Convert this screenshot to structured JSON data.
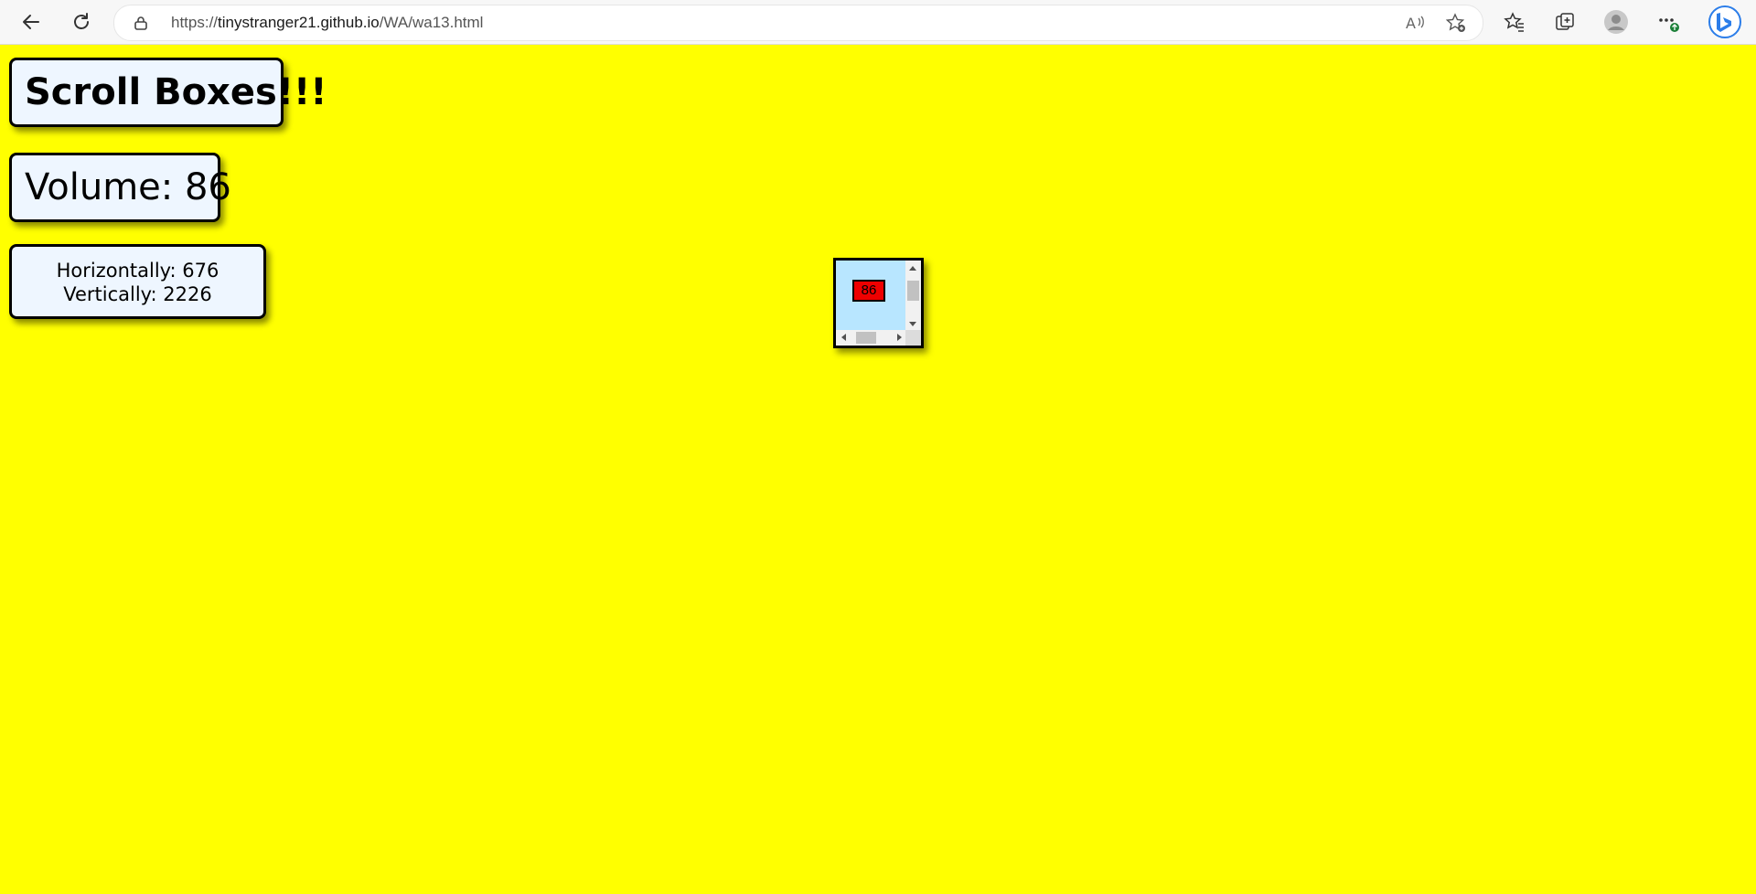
{
  "browser": {
    "url_prefix": "https://",
    "url_host": "tinystranger21.github.io",
    "url_path": "/WA/wa13.html",
    "icons": {
      "back": "back-arrow-icon",
      "refresh": "refresh-icon",
      "lock": "lock-icon",
      "read_aloud": "read-aloud-icon",
      "add_favorite": "add-favorite-icon",
      "favorites": "favorites-icon",
      "collections": "collections-icon",
      "profile": "profile-icon",
      "menu": "more-menu-icon",
      "copilot": "bing-copilot-icon"
    }
  },
  "page": {
    "background": "#ffff00",
    "title": "Scroll Boxes!!!",
    "volume_label": "Volume: 86",
    "horizontal_label": "Horizontally: 676",
    "vertical_label": "Vertically: 2226"
  },
  "scrollbox": {
    "box_value": "86",
    "box_color": "#ee0000",
    "background": "#b8e6ff"
  }
}
